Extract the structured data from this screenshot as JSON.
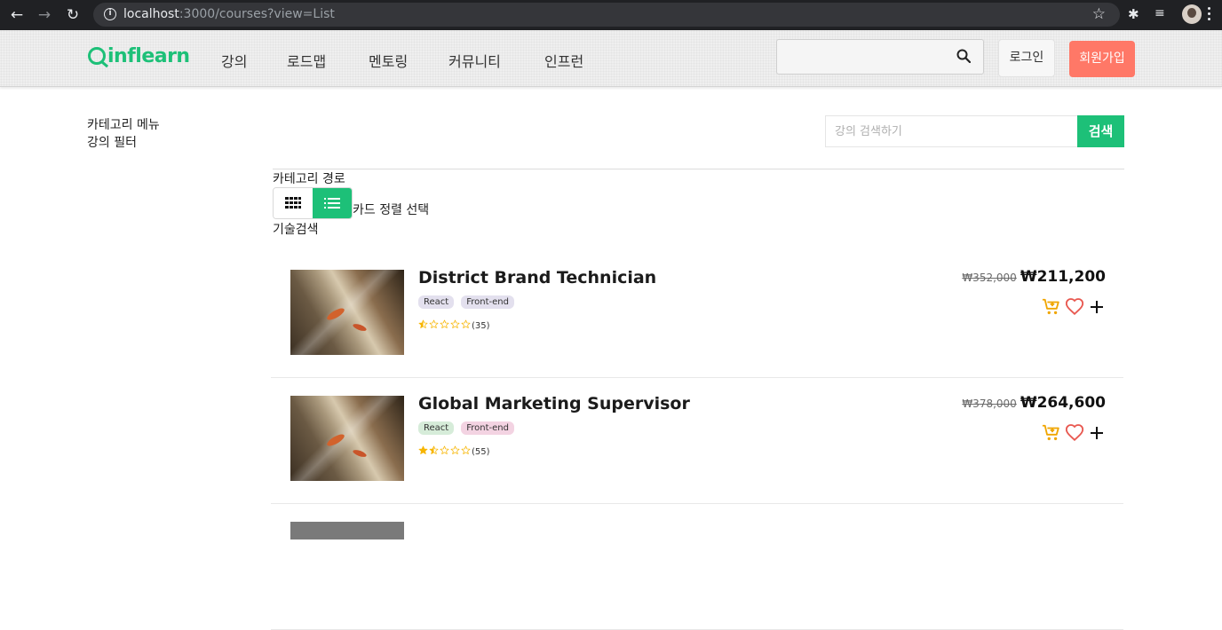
{
  "browser": {
    "url_host": "localhost",
    "url_rest": ":3000/courses?view=List"
  },
  "header": {
    "logo_text": "inflearn",
    "nav": [
      "강의",
      "로드맵",
      "멘토링",
      "커뮤니티",
      "인프런"
    ],
    "search_placeholder": "",
    "login_label": "로그인",
    "signup_label": "회원가입"
  },
  "sidebar": {
    "category_menu": "카테고리 메뉴",
    "course_filter": "강의 필터"
  },
  "course_search": {
    "placeholder": "강의 검색하기",
    "button_label": "검색"
  },
  "main": {
    "category_path": "카테고리 경로",
    "sort_select": "카드 정렬 선택",
    "tech_search": "기술검색",
    "view_mode": "List"
  },
  "courses": [
    {
      "title": "District Brand Technician",
      "tags": [
        {
          "label": "React",
          "color": "#e3e0ee"
        },
        {
          "label": "Front-end",
          "color": "#e3e0ee"
        }
      ],
      "rating": 0.5,
      "review_count": "(35)",
      "original_price": "₩352,000",
      "sale_price": "₩211,200"
    },
    {
      "title": "Global Marketing Supervisor",
      "tags": [
        {
          "label": "React",
          "color": "#d6ecd9"
        },
        {
          "label": "Front-end",
          "color": "#f3d3e2"
        }
      ],
      "rating": 1.5,
      "review_count": "(55)",
      "original_price": "₩378,000",
      "sale_price": "₩264,600"
    }
  ],
  "colors": {
    "brand": "#1dc078",
    "signup": "#ff7867",
    "star": "#f7b500",
    "cart": "#f0a500",
    "heart": "#e8574f"
  },
  "icons": {
    "cart": "add-to-cart-icon",
    "wish": "heart-icon",
    "more": "plus-icon"
  }
}
